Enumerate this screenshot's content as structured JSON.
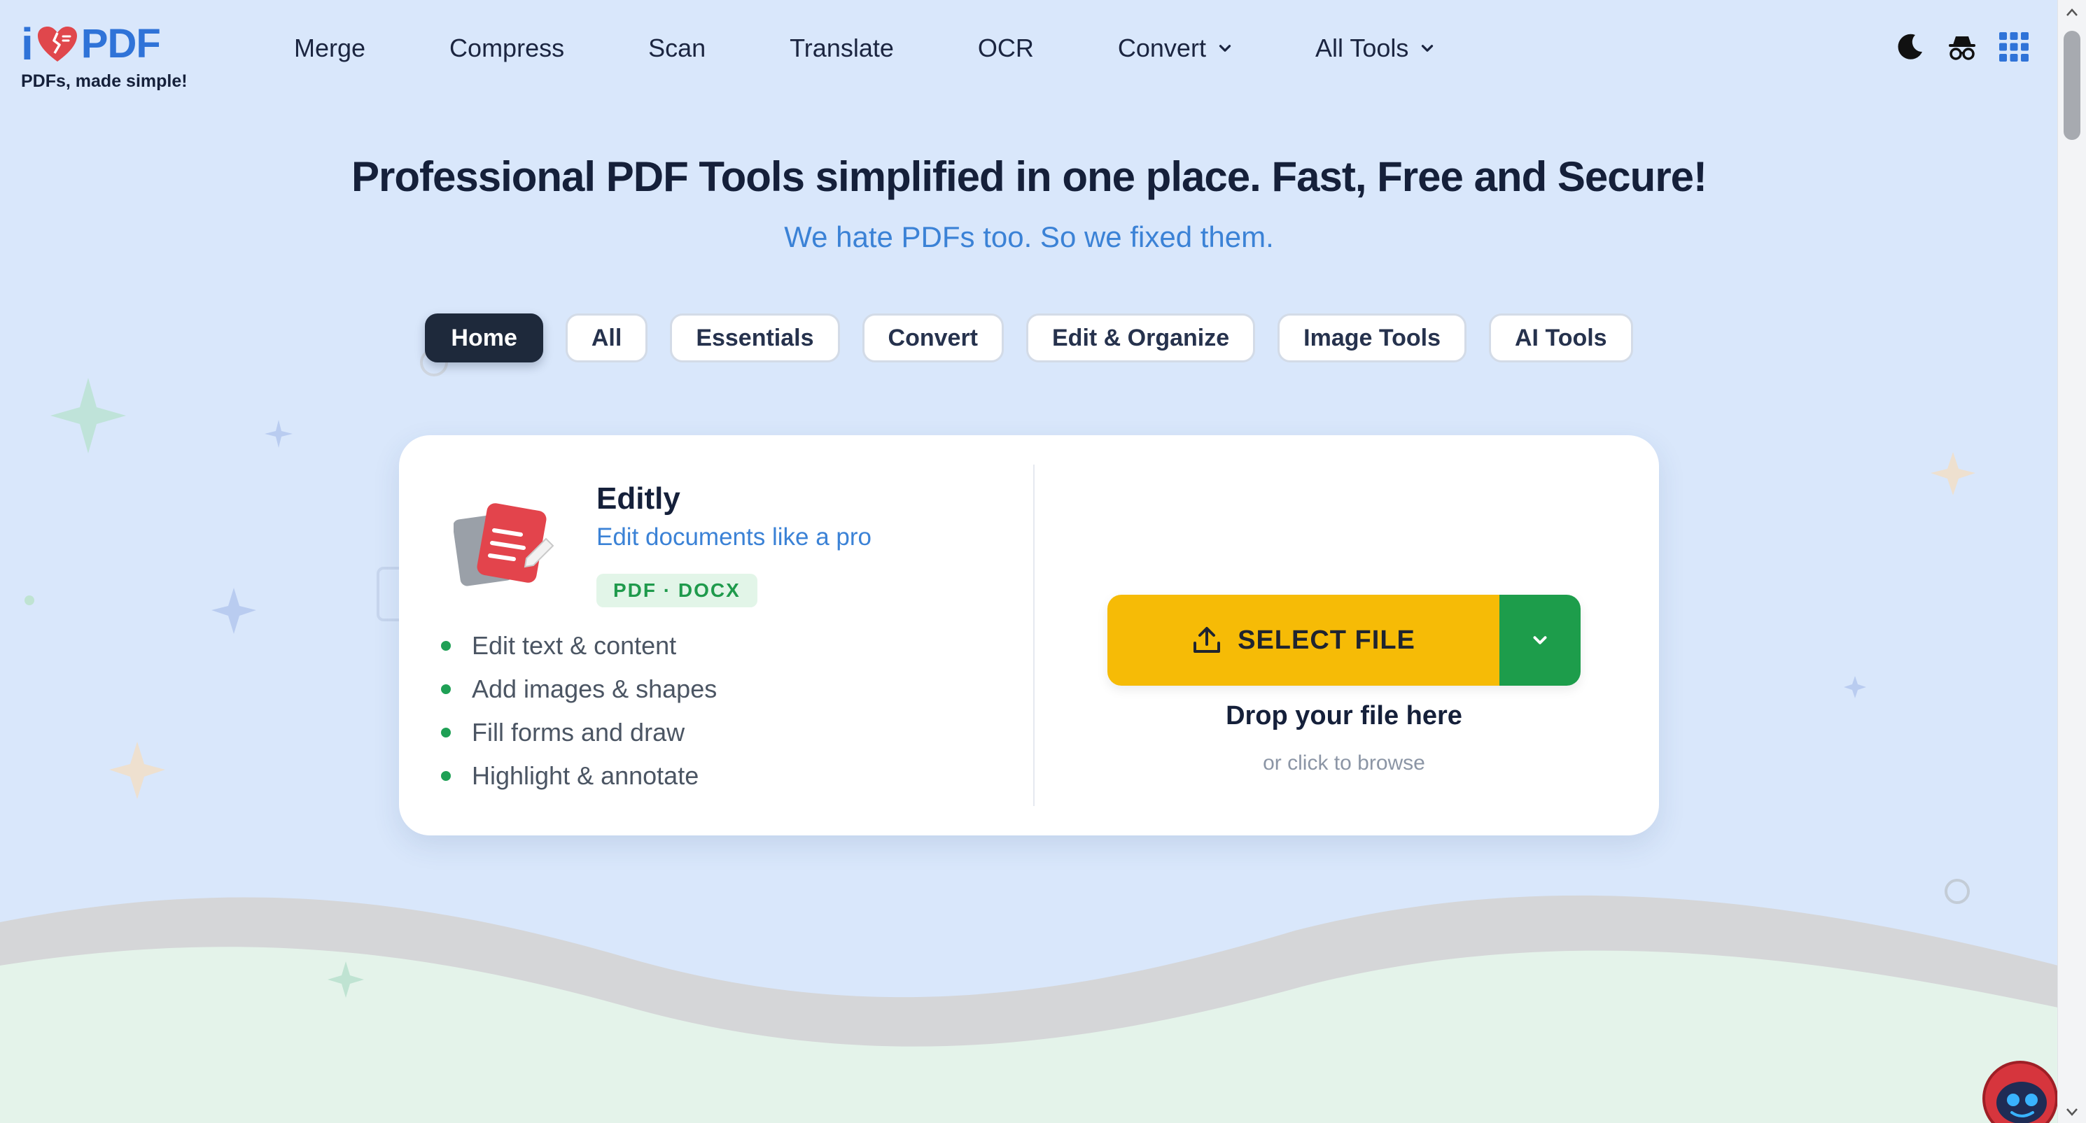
{
  "brand": {
    "logo_letter": "i",
    "logo_text": "PDF",
    "tagline": "PDFs, made simple!",
    "primary_color": "#2f73d8",
    "heart_color": "#e0474c"
  },
  "nav": {
    "items": [
      {
        "label": "Merge"
      },
      {
        "label": "Compress"
      },
      {
        "label": "Scan"
      },
      {
        "label": "Translate"
      },
      {
        "label": "OCR"
      },
      {
        "label": "Convert",
        "has_dropdown": true
      },
      {
        "label": "All Tools",
        "has_dropdown": true
      }
    ]
  },
  "header_icons": [
    "moon-icon",
    "incognito-icon",
    "apps-grid-icon"
  ],
  "hero": {
    "title": "Professional PDF Tools simplified in one place. Fast, Free and Secure!",
    "subtitle": "We hate PDFs too. So we fixed them."
  },
  "categories": {
    "active": "Home",
    "items": [
      {
        "label": "Home"
      },
      {
        "label": "All"
      },
      {
        "label": "Essentials"
      },
      {
        "label": "Convert"
      },
      {
        "label": "Edit & Organize"
      },
      {
        "label": "Image Tools"
      },
      {
        "label": "AI Tools"
      }
    ]
  },
  "tool": {
    "name": "Editly",
    "description": "Edit documents like a pro",
    "formats": "PDF · DOCX",
    "features": [
      "Edit text & content",
      "Add images & shapes",
      "Fill forms and draw",
      "Highlight & annotate"
    ]
  },
  "upload": {
    "button_label": "SELECT FILE",
    "drop_title": "Drop your file here",
    "drop_subtitle": "or click to browse",
    "button_color": "#f6bb06",
    "dropdown_color": "#1d9d4b"
  }
}
